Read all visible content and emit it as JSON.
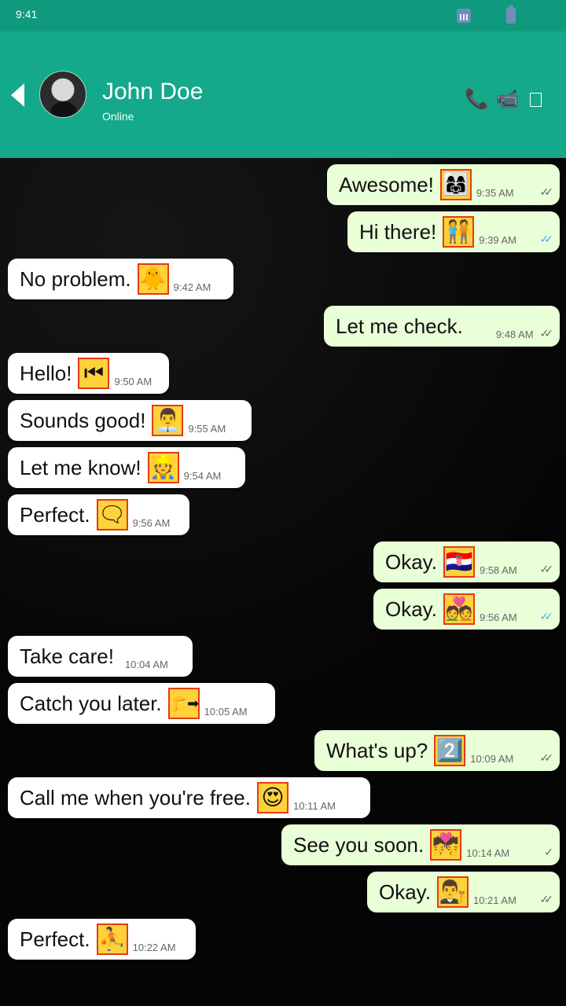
{
  "status_bar": {
    "time": "9:41"
  },
  "header": {
    "contact_name": "John Doe",
    "contact_status": "Online"
  },
  "messages": [
    {
      "text": "Awesome!",
      "time": "9:35 AM",
      "side": "out",
      "emoji": "👩‍👩‍👧",
      "check": "double"
    },
    {
      "text": "Hi there!",
      "time": "9:39 AM",
      "side": "out",
      "emoji": "🧑‍🤝‍🧑",
      "check": "read"
    },
    {
      "text": "No problem.",
      "time": "9:42 AM",
      "side": "in",
      "emoji": "🐥"
    },
    {
      "text": "Let me check.",
      "time": "9:48 AM",
      "side": "out",
      "emoji": "",
      "check": "double"
    },
    {
      "text": "Hello!",
      "time": "9:50 AM",
      "side": "in",
      "emoji": "⏮"
    },
    {
      "text": "Sounds good!",
      "time": "9:55 AM",
      "side": "in",
      "emoji": "👨‍💼"
    },
    {
      "text": "Let me know!",
      "time": "9:54 AM",
      "side": "in",
      "emoji": "👷"
    },
    {
      "text": "Perfect.",
      "time": "9:56 AM",
      "side": "in",
      "emoji": "🗨"
    },
    {
      "text": "Okay.",
      "time": "9:58 AM",
      "side": "out",
      "emoji": "🇭🇷",
      "check": "double"
    },
    {
      "text": "Okay.",
      "time": "9:56 AM",
      "side": "out",
      "emoji": "💑",
      "check": "read"
    },
    {
      "text": "Take care!",
      "time": "10:04 AM",
      "side": "in",
      "emoji": ""
    },
    {
      "text": "Catch you later.",
      "time": "10:05 AM",
      "side": "in",
      "emoji": "🦵➡"
    },
    {
      "text": "What's up?",
      "time": "10:09 AM",
      "side": "out",
      "emoji": "2️⃣",
      "check": "double"
    },
    {
      "text": "Call me when you're free.",
      "time": "10:11 AM",
      "side": "in",
      "emoji": "😍"
    },
    {
      "text": "See you soon.",
      "time": "10:14 AM",
      "side": "out",
      "emoji": "💏",
      "check": "single"
    },
    {
      "text": "Okay.",
      "time": "10:21 AM",
      "side": "out",
      "emoji": "👨‍⚖️",
      "check": "double"
    },
    {
      "text": "Perfect.",
      "time": "10:22 AM",
      "side": "in",
      "emoji": "⛹"
    }
  ]
}
